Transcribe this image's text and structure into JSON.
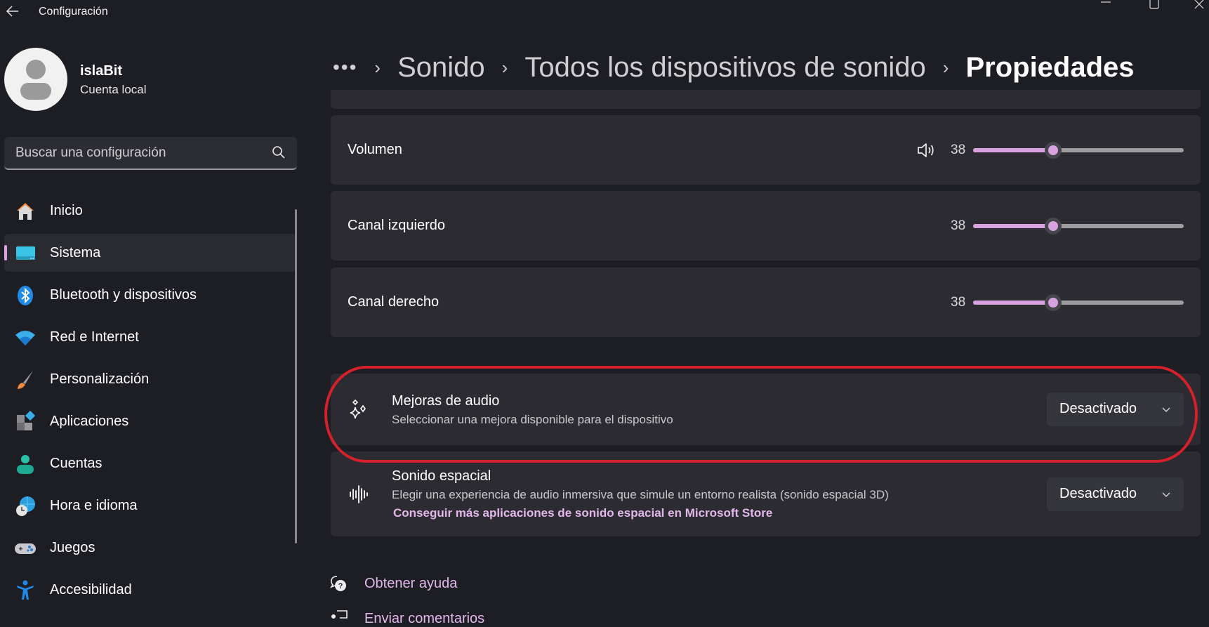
{
  "window": {
    "title": "Configuración",
    "controls": [
      "minimize",
      "maximize",
      "close"
    ]
  },
  "profile": {
    "name": "islaBit",
    "account_type": "Cuenta local"
  },
  "search": {
    "placeholder": "Buscar una configuración",
    "value": ""
  },
  "sidebar": {
    "items": [
      {
        "label": "Inicio",
        "icon": "home-icon",
        "selected": false
      },
      {
        "label": "Sistema",
        "icon": "system-icon",
        "selected": true
      },
      {
        "label": "Bluetooth y dispositivos",
        "icon": "bluetooth-icon",
        "selected": false
      },
      {
        "label": "Red e Internet",
        "icon": "wifi-icon",
        "selected": false
      },
      {
        "label": "Personalización",
        "icon": "brush-icon",
        "selected": false
      },
      {
        "label": "Aplicaciones",
        "icon": "apps-icon",
        "selected": false
      },
      {
        "label": "Cuentas",
        "icon": "accounts-icon",
        "selected": false
      },
      {
        "label": "Hora e idioma",
        "icon": "time-language-icon",
        "selected": false
      },
      {
        "label": "Juegos",
        "icon": "gamepad-icon",
        "selected": false
      },
      {
        "label": "Accesibilidad",
        "icon": "accessibility-icon",
        "selected": false
      }
    ]
  },
  "breadcrumb": {
    "overflow": "•••",
    "items": [
      "Sonido",
      "Todos los dispositivos de sonido",
      "Propiedades"
    ]
  },
  "levels": [
    {
      "label": "Volumen",
      "value": 38,
      "show_speaker_icon": true
    },
    {
      "label": "Canal izquierdo",
      "value": 38,
      "show_speaker_icon": false
    },
    {
      "label": "Canal derecho",
      "value": 38,
      "show_speaker_icon": false
    }
  ],
  "audio_enhancements": {
    "title": "Mejoras de audio",
    "subtitle": "Seleccionar una mejora disponible para el dispositivo",
    "value": "Desactivado"
  },
  "spatial_sound": {
    "title": "Sonido espacial",
    "subtitle": "Elegir una experiencia de audio inmersiva que simule un entorno realista (sonido espacial 3D)",
    "link": "Conseguir más aplicaciones de sonido espacial en Microsoft Store",
    "value": "Desactivado"
  },
  "footer": {
    "help": "Obtener ayuda",
    "feedback": "Enviar comentarios"
  },
  "colors": {
    "accent": "#d7a2df",
    "link": "#e2b8ea",
    "annotation": "#d3212b",
    "background": "#1d1d24",
    "card": "#2b2b31"
  }
}
